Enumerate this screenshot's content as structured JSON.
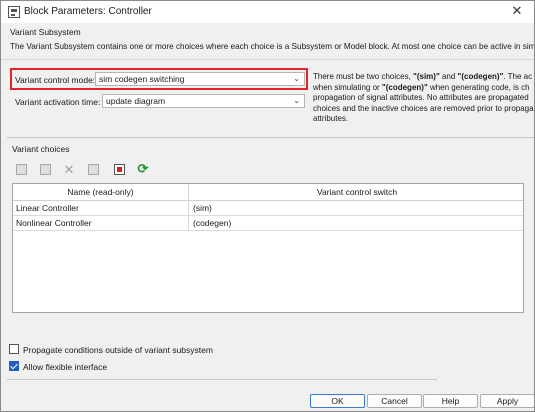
{
  "window": {
    "title": "Block Parameters: Controller"
  },
  "header": {
    "section_title": "Variant Subsystem",
    "description": "The Variant Subsystem contains one or more choices where each choice is a Subsystem or Model block. At most one choice can be active in simulation."
  },
  "params": {
    "control_mode_label": "Variant control mode:",
    "control_mode_value": "sim codegen switching",
    "activation_time_label": "Variant activation time:",
    "activation_time_value": "update diagram"
  },
  "help": {
    "line1_pre": "There must be two choices, ",
    "line1_b1": "\"(sim)\"",
    "line1_mid": " and ",
    "line1_b2": "\"(codegen)\"",
    "line1_post": ". The ac",
    "line2_pre": "when simulating or ",
    "line2_b": "\"(codegen)\"",
    "line2_post": " when generating code, is ch",
    "line3": "propagation of signal attributes. No attributes are propagated",
    "line4": "choices and the inactive choices are removed prior to propaga",
    "line5": "attributes."
  },
  "choices": {
    "group_label": "Variant choices",
    "toolbar": [
      "add-subsystem-icon",
      "add-model-icon",
      "delete-icon",
      "edit-icon",
      "open-block-icon",
      "refresh-icon"
    ],
    "columns": [
      "Name (read-only)",
      "Variant control switch"
    ],
    "rows": [
      {
        "name": "Linear Controller",
        "switch": "(sim)"
      },
      {
        "name": "Nonlinear Controller",
        "switch": "(codegen)"
      }
    ]
  },
  "options": {
    "propagate_label": "Propagate conditions outside of variant subsystem",
    "propagate_checked": false,
    "flexible_label": "Allow flexible interface",
    "flexible_checked": true
  },
  "buttons": {
    "ok": "OK",
    "cancel": "Cancel",
    "help": "Help",
    "apply": "Apply"
  },
  "colors": {
    "highlight": "#e0262a",
    "refresh": "#1c9a2c",
    "checkbox_on": "#1f5fbf"
  }
}
